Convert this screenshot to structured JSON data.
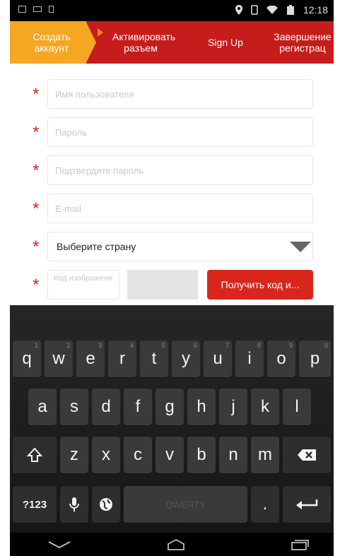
{
  "status": {
    "time": "12:18"
  },
  "steps": [
    {
      "label": "Создать аккаунт",
      "active": true
    },
    {
      "label": "Активировать разъем",
      "active": false
    },
    {
      "label": "Sign Up",
      "active": false
    },
    {
      "label": "Завершение регистрац",
      "active": false
    }
  ],
  "form": {
    "required_mark": "*",
    "username_placeholder": "Имя пользователя",
    "password_placeholder": "Пароль",
    "confirm_placeholder": "Подтвердите пароль",
    "email_placeholder": "E-mail",
    "country_value": "Выберите страну",
    "captcha_placeholder": "Код изображени",
    "get_code_label": "Получить код и..."
  },
  "keyboard": {
    "row1": [
      {
        "k": "q",
        "h": "1"
      },
      {
        "k": "w",
        "h": "2"
      },
      {
        "k": "e",
        "h": "3"
      },
      {
        "k": "r",
        "h": "4"
      },
      {
        "k": "t",
        "h": "5"
      },
      {
        "k": "y",
        "h": "6"
      },
      {
        "k": "u",
        "h": "7"
      },
      {
        "k": "i",
        "h": "8"
      },
      {
        "k": "o",
        "h": "9"
      },
      {
        "k": "p",
        "h": "0"
      }
    ],
    "row2": [
      "a",
      "s",
      "d",
      "f",
      "g",
      "h",
      "j",
      "k",
      "l"
    ],
    "row3": [
      "z",
      "x",
      "c",
      "v",
      "b",
      "n",
      "m"
    ],
    "symbols_label": "?123",
    "space_label": "QWERTY",
    "period_label": "."
  },
  "colors": {
    "accent": "#d9261c",
    "active_step": "#f5a623",
    "steps_bar": "#c61c1c"
  }
}
